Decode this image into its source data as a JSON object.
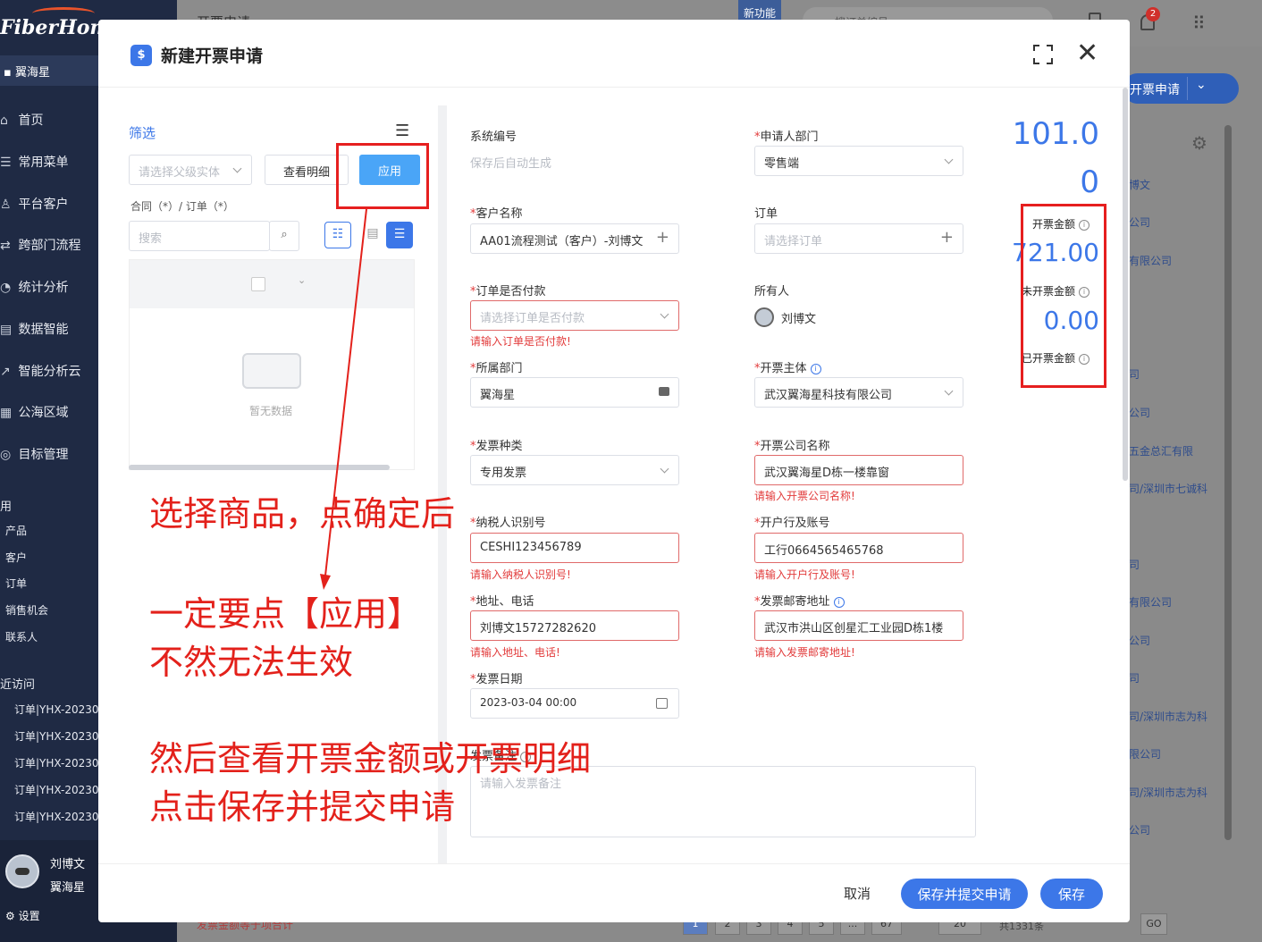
{
  "app": {
    "brand": "FiberHome",
    "org": "翼海星",
    "page_title": "开票申请",
    "new_feature": "新功能",
    "notification_count": "2",
    "search_placeholder": "搜订单编号",
    "create_button": "开票申请",
    "sidebar": [
      {
        "icon": "home-icon",
        "label": "首页"
      },
      {
        "icon": "menu-icon",
        "label": "常用菜单"
      },
      {
        "icon": "customer-icon",
        "label": "平台客户"
      },
      {
        "icon": "flow-icon",
        "label": "跨部门流程"
      },
      {
        "icon": "stats-icon",
        "label": "统计分析"
      },
      {
        "icon": "data-icon",
        "label": "数据智能"
      },
      {
        "icon": "analysis-icon",
        "label": "智能分析云"
      },
      {
        "icon": "region-icon",
        "label": "公海区域"
      },
      {
        "icon": "target-icon",
        "label": "目标管理"
      }
    ],
    "sidebar_section": "用",
    "sidebar_sub": [
      "产品",
      "客户",
      "订单",
      "销售机会",
      "联系人"
    ],
    "recent_title": "近访问",
    "recent": [
      "订单|YHX-20230",
      "订单|YHX-20230",
      "订单|YHX-20230",
      "订单|YHX-20230",
      "订单|YHX-20230"
    ],
    "user_name": "刘博文",
    "user_org": "翼海星",
    "settings": "设置",
    "bg_list": [
      "博文",
      "公司",
      "有限公司",
      "司",
      "公司",
      "五金总汇有限",
      "司/深圳市七诚科",
      "司",
      "有限公司",
      "公司",
      "司",
      "司/深圳市志为科",
      "限公司",
      "司/深圳市志为科",
      "公司"
    ],
    "bottom_note": "发票金额等于项合计",
    "pager": [
      "1",
      "2",
      "3",
      "4",
      "5",
      "...",
      "67"
    ],
    "page_size": "20",
    "total": "共1331条",
    "goto": "GO"
  },
  "modal": {
    "title": "新建开票申请",
    "logo_letter": "$",
    "filter_label": "筛选",
    "parent_entity_placeholder": "请选择父级实体",
    "view_detail_button": "查看明细",
    "apply_button": "应用",
    "contract_order_label": "合同（*）/ 订单（*）",
    "search_placeholder": "搜索",
    "empty_text": "暂无数据",
    "fields": {
      "system_no_label": "系统编号",
      "system_no_value": "保存后自动生成",
      "applicant_dept_label": "申请人部门",
      "applicant_dept_value": "零售端",
      "customer_label": "客户名称",
      "customer_value": "AA01流程测试（客户）-刘博文",
      "order_label": "订单",
      "order_placeholder": "请选择订单",
      "paid_label": "订单是否付款",
      "paid_placeholder": "请选择订单是否付款",
      "paid_error": "请输入订单是否付款!",
      "owner_label": "所有人",
      "owner_value": "刘博文",
      "dept_label": "所属部门",
      "dept_value": "翼海星",
      "entity_label": "开票主体",
      "entity_value": "武汉翼海星科技有限公司",
      "invoice_type_label": "发票种类",
      "invoice_type_value": "专用发票",
      "company_label": "开票公司名称",
      "company_value": "武汉翼海星D栋一楼靠窗",
      "company_error": "请输入开票公司名称!",
      "taxid_label": "纳税人识别号",
      "taxid_value": "CESHI123456789",
      "taxid_error": "请输入纳税人识别号!",
      "bank_label": "开户行及账号",
      "bank_value": "工行0664565465768",
      "bank_error": "请输入开户行及账号!",
      "address_label": "地址、电话",
      "address_value": "刘博文15727282620",
      "address_error": "请输入地址、电话!",
      "mail_label": "发票邮寄地址",
      "mail_value": "武汉市洪山区创星汇工业园D栋1楼",
      "mail_error": "请输入发票邮寄地址!",
      "date_label": "发票日期",
      "date_value": "2023-03-04 00:00",
      "remark_label": "发票备注",
      "remark_placeholder": "请输入发票备注"
    },
    "amounts": {
      "invoice_amount_line1": "101.0",
      "invoice_amount_line2": "0",
      "invoice_amount_label": "开票金额",
      "uninvoiced_amount": "721.00",
      "uninvoiced_label": "未开票金额",
      "invoiced_amount": "0.00",
      "invoiced_label": "已开票金额"
    },
    "footer": {
      "cancel": "取消",
      "save_submit": "保存并提交申请",
      "save": "保存"
    }
  },
  "annotations": {
    "line1": "选择商品，点确定后",
    "line2": "一定要点【应用】",
    "line3": "不然无法生效",
    "line4": "然后查看开票金额或开票明细",
    "line5": "点击保存并提交申请",
    "color": "#e3211b"
  }
}
